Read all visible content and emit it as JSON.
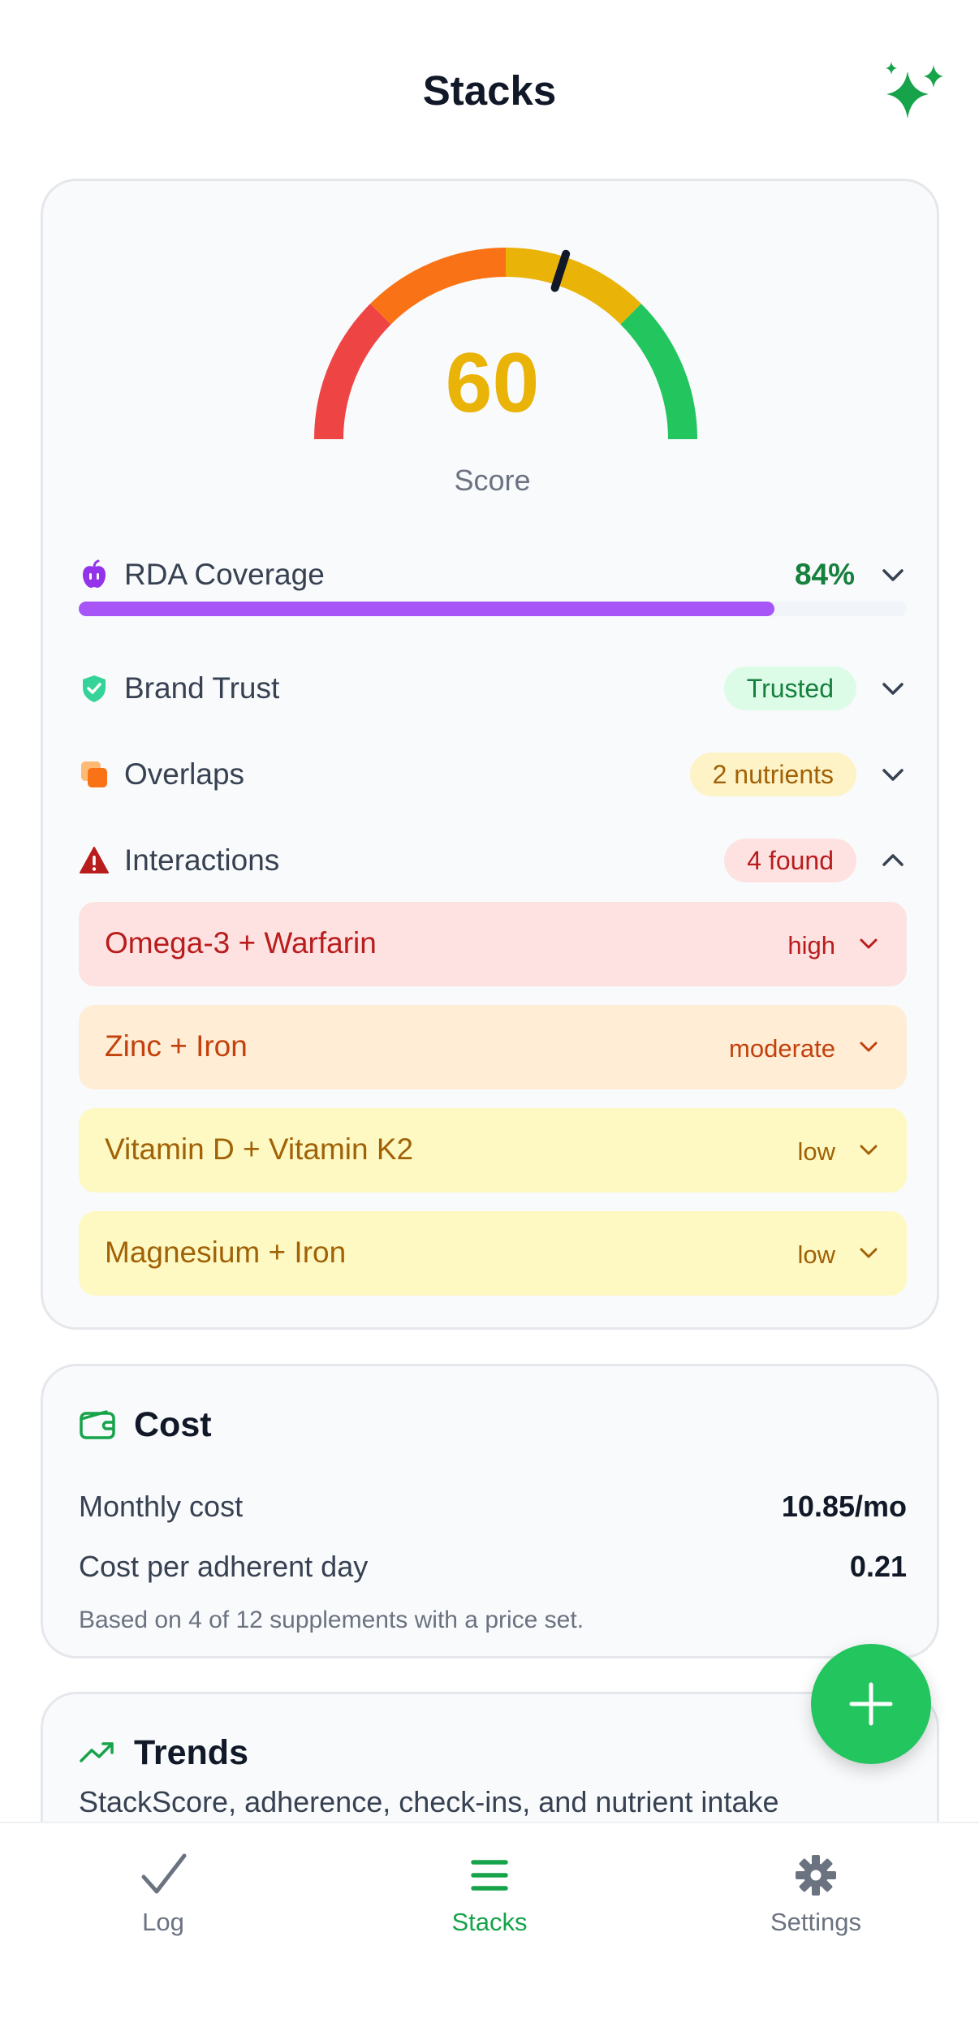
{
  "header": {
    "title": "Stacks",
    "action_icon": "sparkles-icon"
  },
  "score": {
    "value": "60",
    "label": "Score",
    "gauge_fraction": 0.6,
    "gauge_colors": [
      "#ef4444",
      "#f97316",
      "#eab308",
      "#22c55e"
    ]
  },
  "rda": {
    "label": "RDA Coverage",
    "percent_text": "84%",
    "fraction": 0.84,
    "icon": "apple-icon"
  },
  "brand_trust": {
    "label": "Brand Trust",
    "badge": "Trusted",
    "icon": "shield-check-icon"
  },
  "overlaps": {
    "label": "Overlaps",
    "badge": "2 nutrients",
    "icon": "overlap-squares-icon"
  },
  "interactions": {
    "label": "Interactions",
    "badge": "4 found",
    "icon": "warning-triangle-icon",
    "items": [
      {
        "name": "Omega-3 + Warfarin",
        "severity": "high"
      },
      {
        "name": "Zinc + Iron",
        "severity": "moderate"
      },
      {
        "name": "Vitamin D + Vitamin K2",
        "severity": "low"
      },
      {
        "name": "Magnesium + Iron",
        "severity": "low"
      }
    ]
  },
  "cost": {
    "title": "Cost",
    "icon": "wallet-icon",
    "monthly_label": "Monthly cost",
    "monthly_value": "10.85/mo",
    "per_day_label": "Cost per adherent day",
    "per_day_value": "0.21",
    "note": "Based on 4 of 12 supplements with a price set."
  },
  "trends": {
    "title": "Trends",
    "icon": "trending-up-icon",
    "subtitle": "StackScore, adherence, check-ins, and nutrient intake"
  },
  "fab": {
    "icon": "plus-icon"
  },
  "tabs": [
    {
      "label": "Log",
      "icon": "checkmark-icon",
      "active": false
    },
    {
      "label": "Stacks",
      "icon": "list-icon",
      "active": true
    },
    {
      "label": "Settings",
      "icon": "gear-icon",
      "active": false
    }
  ],
  "colors": {
    "accent": "#16a34a",
    "rda_bar": "#a855f7",
    "score": "#eab308"
  }
}
